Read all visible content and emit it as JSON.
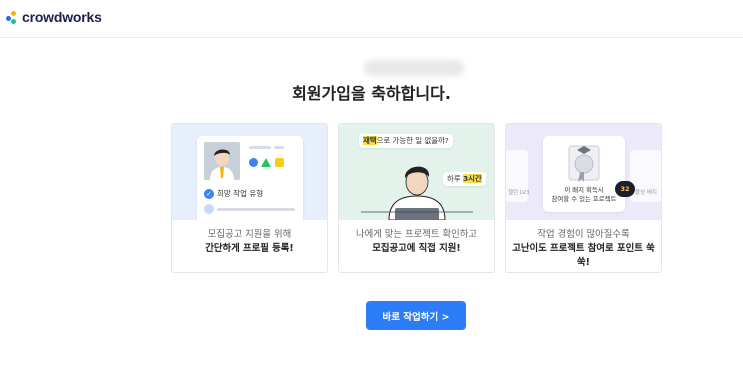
{
  "brand": {
    "name": "crowdworks",
    "dot_colors": [
      "#1e6df5",
      "#f5b800",
      "#24c28a"
    ]
  },
  "welcome": {
    "title": "회원가입을 축하합니다."
  },
  "cards": [
    {
      "line1": "모집공고 지원을 위해",
      "line2": "간단하게 프로필 등록!",
      "art": {
        "check_label": "희망 작업 유형",
        "shape_colors": [
          "#3b82f6",
          "#22c55e",
          "#facc15"
        ]
      }
    },
    {
      "line1": "나에게 맞는 프로젝트 확인하고",
      "line2": "모집공고에 직접 지원!",
      "art": {
        "bubble1_hl": "재택",
        "bubble1_rest": "으로 가능한 일 없을까?",
        "bubble2_rest": "하루 ",
        "bubble2_hl": "3시간"
      }
    },
    {
      "line1": "작업 경험이 많아질수록",
      "line2": "고난이도 프로젝트 참여로 포인트 쑥쑥!",
      "art": {
        "badge_line1": "이 배지 획득시",
        "badge_line2": "참여할 수 있는 프로젝트",
        "chip": "32",
        "left_label": "챌린 LV3",
        "right_label": "플성 배지"
      }
    }
  ],
  "cta": {
    "label": "바로 작업하기 >"
  }
}
